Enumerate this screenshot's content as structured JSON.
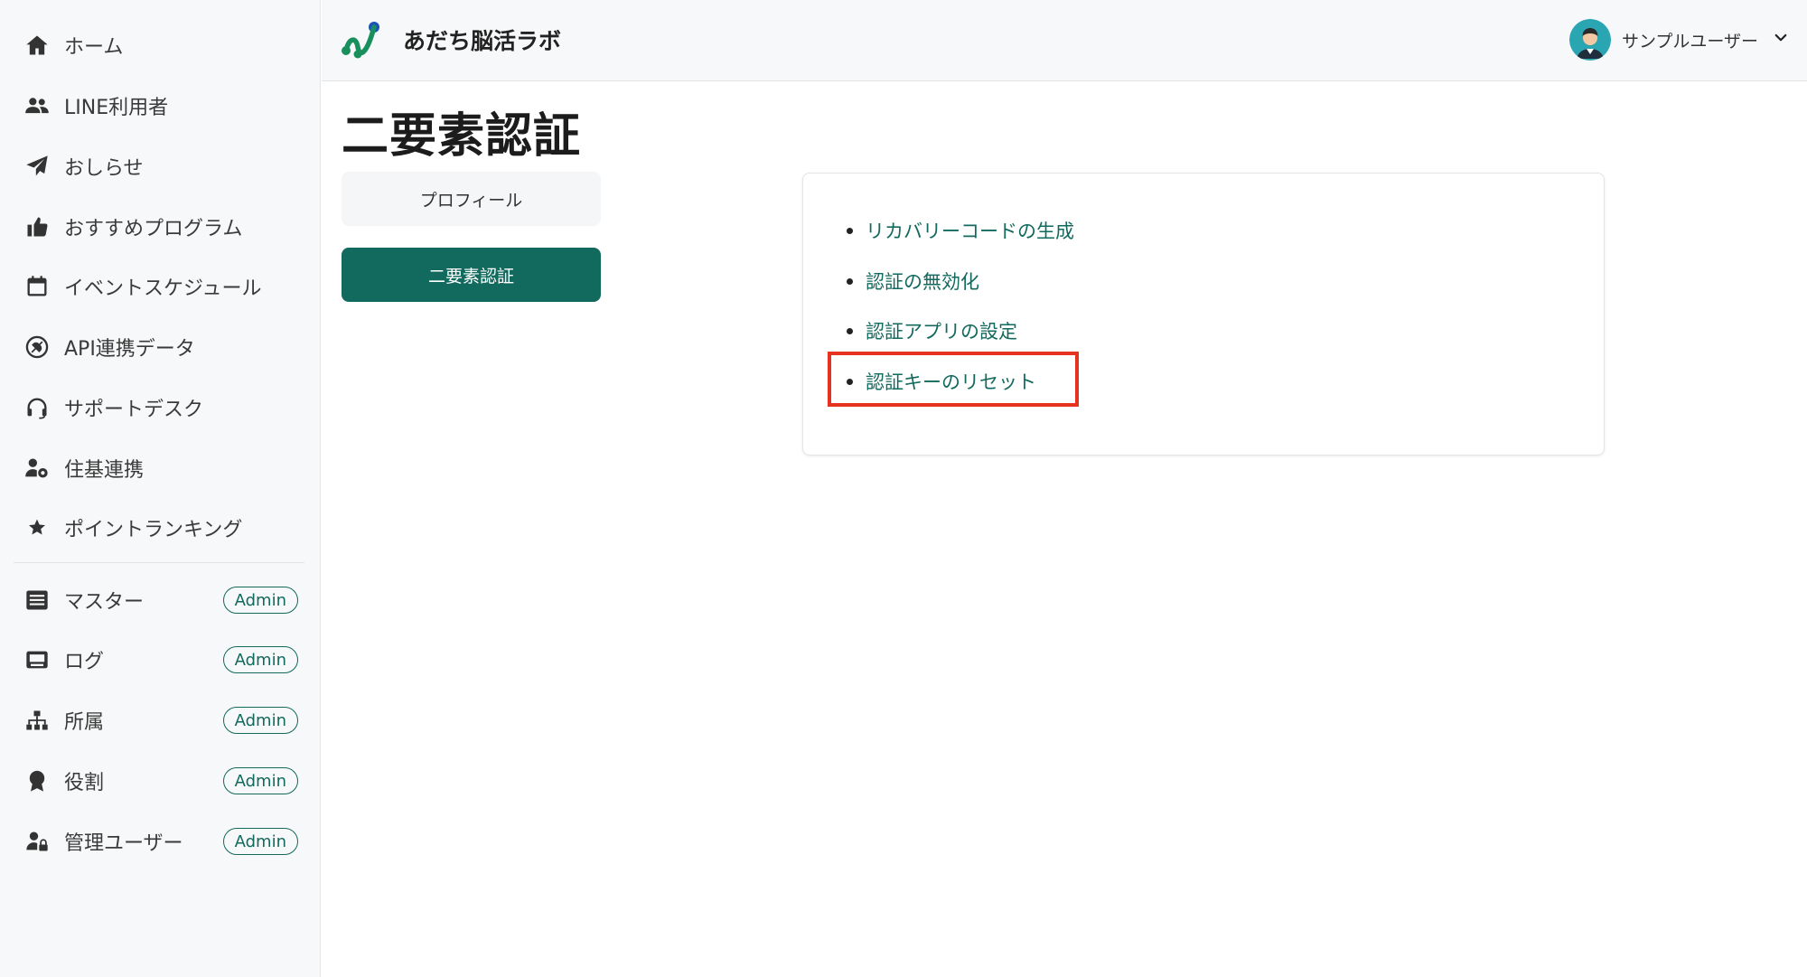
{
  "app": {
    "title": "あだち脳活ラボ"
  },
  "user": {
    "name": "サンプルユーザー"
  },
  "sidebar": {
    "items": [
      {
        "label": "ホーム",
        "icon": "home-icon"
      },
      {
        "label": "LINE利用者",
        "icon": "users-icon"
      },
      {
        "label": "おしらせ",
        "icon": "send-icon"
      },
      {
        "label": "おすすめプログラム",
        "icon": "thumbs-up-icon"
      },
      {
        "label": "イベントスケジュール",
        "icon": "calendar-icon"
      },
      {
        "label": "API連携データ",
        "icon": "api-icon"
      },
      {
        "label": "サポートデスク",
        "icon": "headset-icon"
      },
      {
        "label": "住基連携",
        "icon": "user-gear-icon"
      },
      {
        "label": "ポイントランキング",
        "icon": "star-icon"
      }
    ],
    "admin_items": [
      {
        "label": "マスター",
        "icon": "database-icon",
        "badge": "Admin"
      },
      {
        "label": "ログ",
        "icon": "log-icon",
        "badge": "Admin"
      },
      {
        "label": "所属",
        "icon": "sitemap-icon",
        "badge": "Admin"
      },
      {
        "label": "役割",
        "icon": "award-icon",
        "badge": "Admin"
      },
      {
        "label": "管理ユーザー",
        "icon": "user-lock-icon",
        "badge": "Admin"
      }
    ]
  },
  "page": {
    "title": "二要素認証",
    "tabs": [
      {
        "label": "プロフィール",
        "active": false
      },
      {
        "label": "二要素認証",
        "active": true
      }
    ],
    "links": [
      "リカバリーコードの生成",
      "認証の無効化",
      "認証アプリの設定",
      "認証キーのリセット"
    ],
    "highlighted_link": "認証キーのリセット"
  },
  "colors": {
    "accent": "#12695e",
    "highlight": "#e53320",
    "sidebar_bg": "#f7f8f9"
  }
}
